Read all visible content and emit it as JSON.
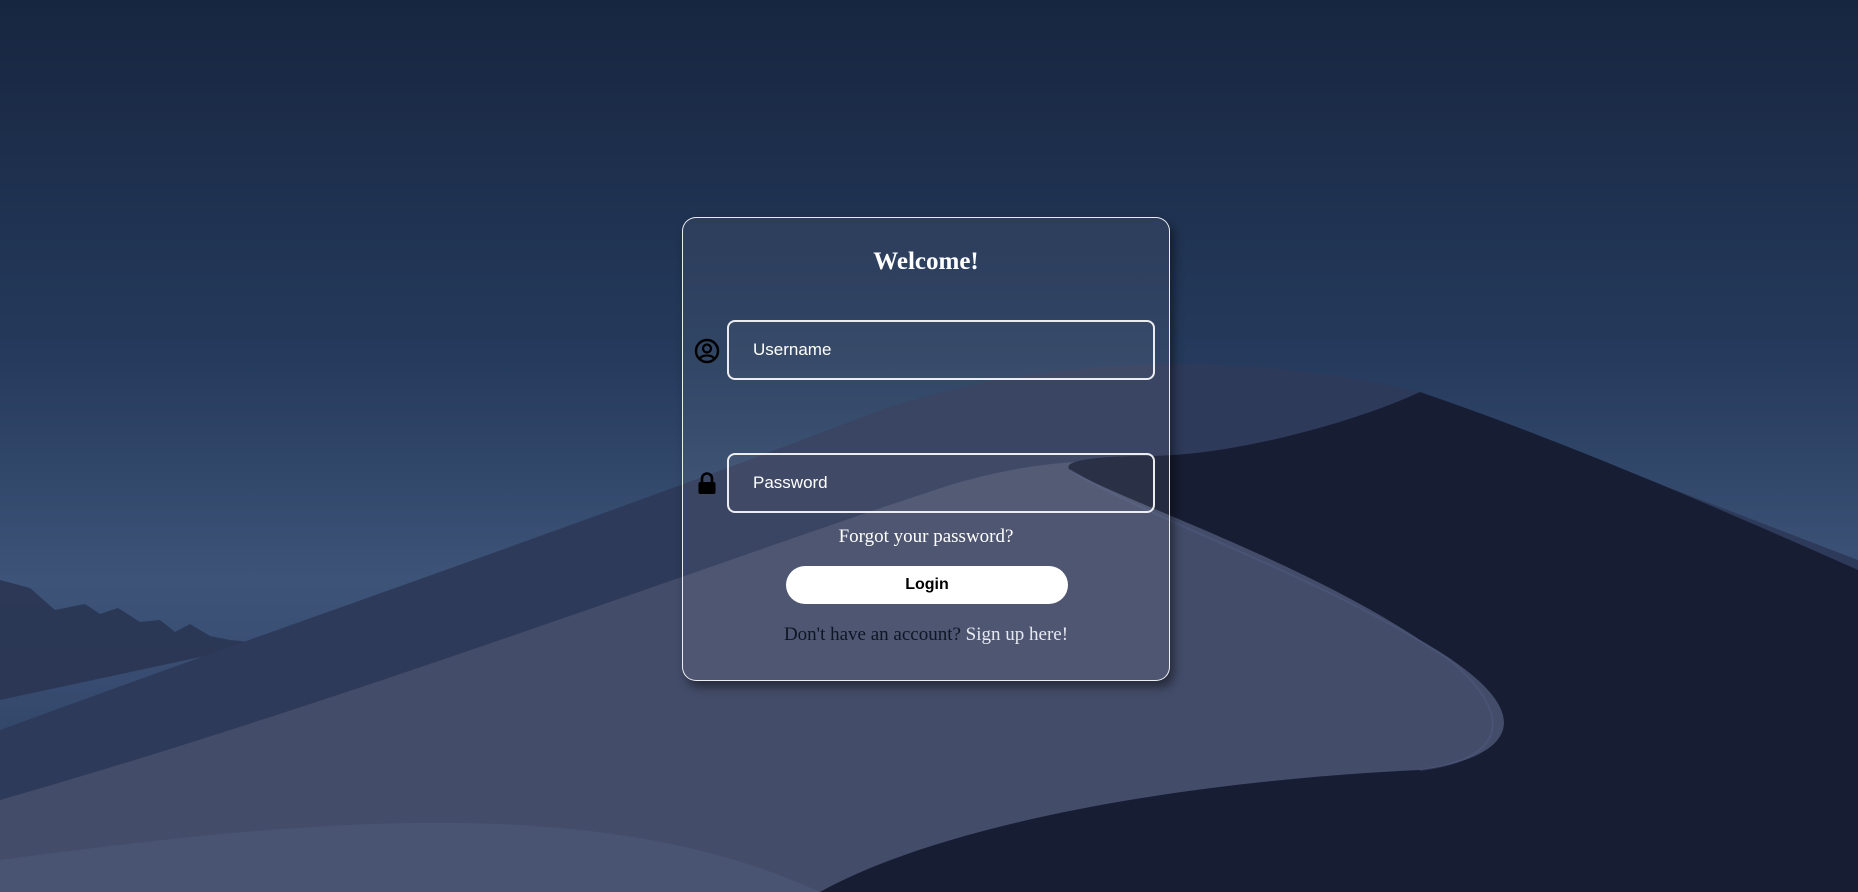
{
  "login_card": {
    "title": "Welcome!",
    "username": {
      "placeholder": "Username",
      "value": "",
      "icon": "user-circle-icon"
    },
    "password": {
      "placeholder": "Password",
      "value": "",
      "icon": "lock-icon"
    },
    "forgot_password_label": "Forgot your password?",
    "login_button_label": "Login",
    "signup_prompt": "Don't have an account?",
    "signup_link_label": "Sign up here!"
  },
  "colors": {
    "background_top": "#172640",
    "background_mid": "#3d5478",
    "dune_dark": "#161d33",
    "dune_light": "#464f6c",
    "card_border": "#ffffff",
    "button_bg": "#ffffff",
    "button_text": "#000000",
    "text_light": "#ffffff",
    "text_dark": "#0e1626"
  }
}
